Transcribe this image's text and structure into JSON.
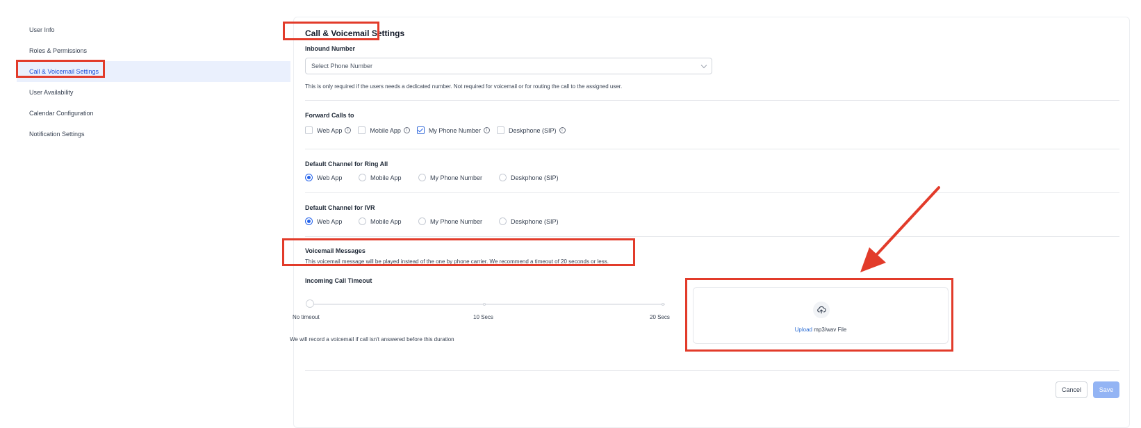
{
  "sidebar": {
    "items": [
      {
        "label": "User Info"
      },
      {
        "label": "Roles & Permissions"
      },
      {
        "label": "Call & Voicemail Settings",
        "active": true
      },
      {
        "label": "User Availability"
      },
      {
        "label": "Calendar Configuration"
      },
      {
        "label": "Notification Settings"
      }
    ]
  },
  "main": {
    "title": "Call & Voicemail Settings",
    "inbound": {
      "label": "Inbound Number",
      "placeholder": "Select Phone Number",
      "hint": "This is only required if the users needs a dedicated number. Not required for voicemail or for routing the call to the assigned user."
    },
    "forward": {
      "label": "Forward Calls to",
      "options": [
        {
          "label": "Web App",
          "checked": false
        },
        {
          "label": "Mobile App",
          "checked": false
        },
        {
          "label": "My Phone Number",
          "checked": true
        },
        {
          "label": "Deskphone (SIP)",
          "checked": false
        }
      ]
    },
    "ring_all": {
      "label": "Default Channel for Ring All",
      "options": [
        "Web App",
        "Mobile App",
        "My Phone Number",
        "Deskphone (SIP)"
      ],
      "selected": "Web App"
    },
    "ivr": {
      "label": "Default Channel for IVR",
      "options": [
        "Web App",
        "Mobile App",
        "My Phone Number",
        "Deskphone (SIP)"
      ],
      "selected": "Web App"
    },
    "voicemail": {
      "label": "Voicemail Messages",
      "description": "This voicemail message will be played instead of the one by phone carrier. We recommend a timeout of 20 seconds or less.",
      "timeout_label": "Incoming Call Timeout",
      "slider_labels": [
        "No timeout",
        "10 Secs",
        "20 Secs"
      ],
      "slider_value": "No timeout",
      "timeout_hint": "We will record a voicemail if call isn't answered before this duration",
      "upload_link": "Upload",
      "upload_text": " mp3/wav File"
    },
    "buttons": {
      "cancel": "Cancel",
      "save": "Save"
    }
  },
  "colors": {
    "accent": "#2563eb",
    "active_bg": "#eaf0fd",
    "annotation": "#e23b2a",
    "save_disabled": "#93b4f4"
  },
  "icons": [
    "info-icon",
    "chevron-down-icon",
    "upload-cloud-icon",
    "annotation-arrow"
  ]
}
